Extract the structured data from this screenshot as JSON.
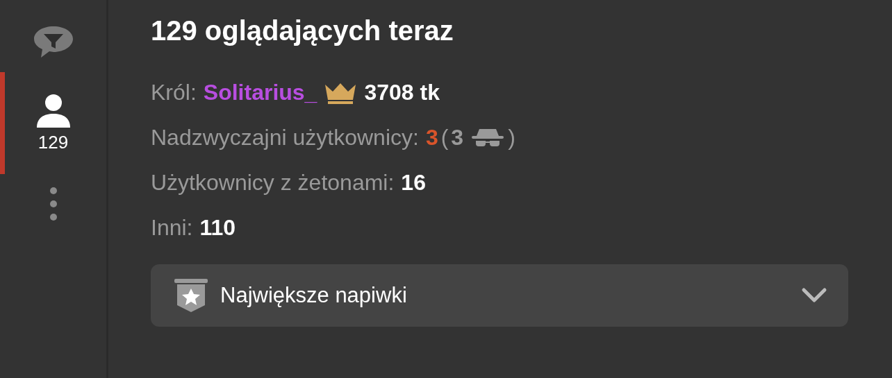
{
  "sidebar": {
    "items": [
      {
        "kind": "chat",
        "selected": false
      },
      {
        "kind": "users",
        "selected": true,
        "count": "129"
      },
      {
        "kind": "more",
        "selected": false
      }
    ]
  },
  "title": "129 oglądających teraz",
  "king": {
    "label": "Król:",
    "name": "Solitarius_",
    "tokens": "3708 tk"
  },
  "stats": [
    {
      "kind": "special",
      "label": "Nadzwyczajni użytkownicy:",
      "value": "3",
      "open": "(",
      "hidden": "3",
      "close": ")"
    },
    {
      "kind": "plain",
      "label": "Użytkownicy z żetonami:",
      "value": "16"
    },
    {
      "kind": "plain",
      "label": "Inni:",
      "value": "110"
    }
  ],
  "top_tips": {
    "label": "Największe napiwki",
    "expanded": false
  }
}
